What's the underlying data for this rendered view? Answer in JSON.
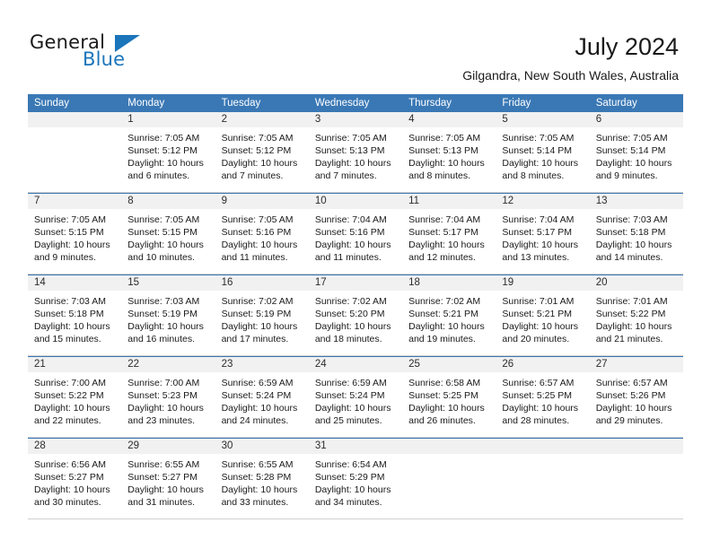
{
  "brand": {
    "name_part1": "General",
    "name_part2": "Blue",
    "accent_color": "#1b75bb"
  },
  "header": {
    "title": "July 2024",
    "subtitle": "Gilgandra, New South Wales, Australia"
  },
  "calendar": {
    "header_color": "#3a78b5",
    "weekdays": [
      "Sunday",
      "Monday",
      "Tuesday",
      "Wednesday",
      "Thursday",
      "Friday",
      "Saturday"
    ],
    "weeks": [
      [
        {
          "day": "",
          "lines": []
        },
        {
          "day": "1",
          "lines": [
            "Sunrise: 7:05 AM",
            "Sunset: 5:12 PM",
            "Daylight: 10 hours",
            "and 6 minutes."
          ]
        },
        {
          "day": "2",
          "lines": [
            "Sunrise: 7:05 AM",
            "Sunset: 5:12 PM",
            "Daylight: 10 hours",
            "and 7 minutes."
          ]
        },
        {
          "day": "3",
          "lines": [
            "Sunrise: 7:05 AM",
            "Sunset: 5:13 PM",
            "Daylight: 10 hours",
            "and 7 minutes."
          ]
        },
        {
          "day": "4",
          "lines": [
            "Sunrise: 7:05 AM",
            "Sunset: 5:13 PM",
            "Daylight: 10 hours",
            "and 8 minutes."
          ]
        },
        {
          "day": "5",
          "lines": [
            "Sunrise: 7:05 AM",
            "Sunset: 5:14 PM",
            "Daylight: 10 hours",
            "and 8 minutes."
          ]
        },
        {
          "day": "6",
          "lines": [
            "Sunrise: 7:05 AM",
            "Sunset: 5:14 PM",
            "Daylight: 10 hours",
            "and 9 minutes."
          ]
        }
      ],
      [
        {
          "day": "7",
          "lines": [
            "Sunrise: 7:05 AM",
            "Sunset: 5:15 PM",
            "Daylight: 10 hours",
            "and 9 minutes."
          ]
        },
        {
          "day": "8",
          "lines": [
            "Sunrise: 7:05 AM",
            "Sunset: 5:15 PM",
            "Daylight: 10 hours",
            "and 10 minutes."
          ]
        },
        {
          "day": "9",
          "lines": [
            "Sunrise: 7:05 AM",
            "Sunset: 5:16 PM",
            "Daylight: 10 hours",
            "and 11 minutes."
          ]
        },
        {
          "day": "10",
          "lines": [
            "Sunrise: 7:04 AM",
            "Sunset: 5:16 PM",
            "Daylight: 10 hours",
            "and 11 minutes."
          ]
        },
        {
          "day": "11",
          "lines": [
            "Sunrise: 7:04 AM",
            "Sunset: 5:17 PM",
            "Daylight: 10 hours",
            "and 12 minutes."
          ]
        },
        {
          "day": "12",
          "lines": [
            "Sunrise: 7:04 AM",
            "Sunset: 5:17 PM",
            "Daylight: 10 hours",
            "and 13 minutes."
          ]
        },
        {
          "day": "13",
          "lines": [
            "Sunrise: 7:03 AM",
            "Sunset: 5:18 PM",
            "Daylight: 10 hours",
            "and 14 minutes."
          ]
        }
      ],
      [
        {
          "day": "14",
          "lines": [
            "Sunrise: 7:03 AM",
            "Sunset: 5:18 PM",
            "Daylight: 10 hours",
            "and 15 minutes."
          ]
        },
        {
          "day": "15",
          "lines": [
            "Sunrise: 7:03 AM",
            "Sunset: 5:19 PM",
            "Daylight: 10 hours",
            "and 16 minutes."
          ]
        },
        {
          "day": "16",
          "lines": [
            "Sunrise: 7:02 AM",
            "Sunset: 5:19 PM",
            "Daylight: 10 hours",
            "and 17 minutes."
          ]
        },
        {
          "day": "17",
          "lines": [
            "Sunrise: 7:02 AM",
            "Sunset: 5:20 PM",
            "Daylight: 10 hours",
            "and 18 minutes."
          ]
        },
        {
          "day": "18",
          "lines": [
            "Sunrise: 7:02 AM",
            "Sunset: 5:21 PM",
            "Daylight: 10 hours",
            "and 19 minutes."
          ]
        },
        {
          "day": "19",
          "lines": [
            "Sunrise: 7:01 AM",
            "Sunset: 5:21 PM",
            "Daylight: 10 hours",
            "and 20 minutes."
          ]
        },
        {
          "day": "20",
          "lines": [
            "Sunrise: 7:01 AM",
            "Sunset: 5:22 PM",
            "Daylight: 10 hours",
            "and 21 minutes."
          ]
        }
      ],
      [
        {
          "day": "21",
          "lines": [
            "Sunrise: 7:00 AM",
            "Sunset: 5:22 PM",
            "Daylight: 10 hours",
            "and 22 minutes."
          ]
        },
        {
          "day": "22",
          "lines": [
            "Sunrise: 7:00 AM",
            "Sunset: 5:23 PM",
            "Daylight: 10 hours",
            "and 23 minutes."
          ]
        },
        {
          "day": "23",
          "lines": [
            "Sunrise: 6:59 AM",
            "Sunset: 5:24 PM",
            "Daylight: 10 hours",
            "and 24 minutes."
          ]
        },
        {
          "day": "24",
          "lines": [
            "Sunrise: 6:59 AM",
            "Sunset: 5:24 PM",
            "Daylight: 10 hours",
            "and 25 minutes."
          ]
        },
        {
          "day": "25",
          "lines": [
            "Sunrise: 6:58 AM",
            "Sunset: 5:25 PM",
            "Daylight: 10 hours",
            "and 26 minutes."
          ]
        },
        {
          "day": "26",
          "lines": [
            "Sunrise: 6:57 AM",
            "Sunset: 5:25 PM",
            "Daylight: 10 hours",
            "and 28 minutes."
          ]
        },
        {
          "day": "27",
          "lines": [
            "Sunrise: 6:57 AM",
            "Sunset: 5:26 PM",
            "Daylight: 10 hours",
            "and 29 minutes."
          ]
        }
      ],
      [
        {
          "day": "28",
          "lines": [
            "Sunrise: 6:56 AM",
            "Sunset: 5:27 PM",
            "Daylight: 10 hours",
            "and 30 minutes."
          ]
        },
        {
          "day": "29",
          "lines": [
            "Sunrise: 6:55 AM",
            "Sunset: 5:27 PM",
            "Daylight: 10 hours",
            "and 31 minutes."
          ]
        },
        {
          "day": "30",
          "lines": [
            "Sunrise: 6:55 AM",
            "Sunset: 5:28 PM",
            "Daylight: 10 hours",
            "and 33 minutes."
          ]
        },
        {
          "day": "31",
          "lines": [
            "Sunrise: 6:54 AM",
            "Sunset: 5:29 PM",
            "Daylight: 10 hours",
            "and 34 minutes."
          ]
        },
        {
          "day": "",
          "lines": []
        },
        {
          "day": "",
          "lines": []
        },
        {
          "day": "",
          "lines": []
        }
      ]
    ]
  }
}
